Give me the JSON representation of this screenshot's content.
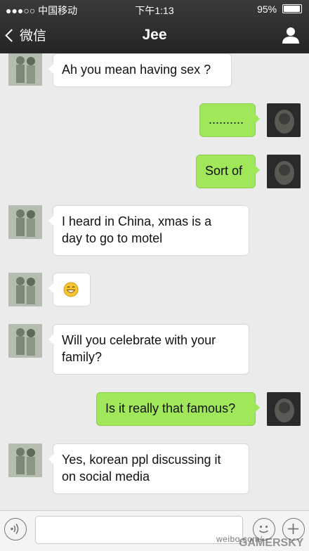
{
  "status_bar": {
    "carrier": "●●●○○ 中国移动",
    "time": "下午1:13",
    "battery": "95%",
    "battery_level": 0.95
  },
  "nav": {
    "back_label": "微信",
    "title": "Jee",
    "profile_icon": "person-icon"
  },
  "messages": [
    {
      "sender": "Jee",
      "direction": "in",
      "text": "Ah you mean having sex ?"
    },
    {
      "sender": "me",
      "direction": "out",
      "text": ".........."
    },
    {
      "sender": "me",
      "direction": "out",
      "text": "Sort of"
    },
    {
      "sender": "Jee",
      "direction": "in",
      "lines": [
        "I heard in China, xmas is a",
        "day to go to motel"
      ]
    },
    {
      "sender": "Jee",
      "direction": "in",
      "emoji": "😄"
    },
    {
      "sender": "Jee",
      "direction": "in",
      "lines": [
        "Will you celebrate with your",
        "family?"
      ]
    },
    {
      "sender": "me",
      "direction": "out",
      "text": "Is it really that famous?"
    },
    {
      "sender": "Jee",
      "direction": "in",
      "lines": [
        "Yes, korean ppl discussing it",
        "on social media"
      ]
    }
  ],
  "input_bar": {
    "voice_icon": "voice-icon",
    "emoji_icon": "emoji-icon",
    "plus_icon": "plus-icon"
  },
  "watermark": {
    "text1": "weibo.com/",
    "text2": "GAMERSKY"
  },
  "colors": {
    "topbar": "#2e2e2e",
    "outgoing_bubble": "#a0e75a",
    "incoming_bubble": "#ffffff",
    "chat_background": "#ebebeb"
  }
}
